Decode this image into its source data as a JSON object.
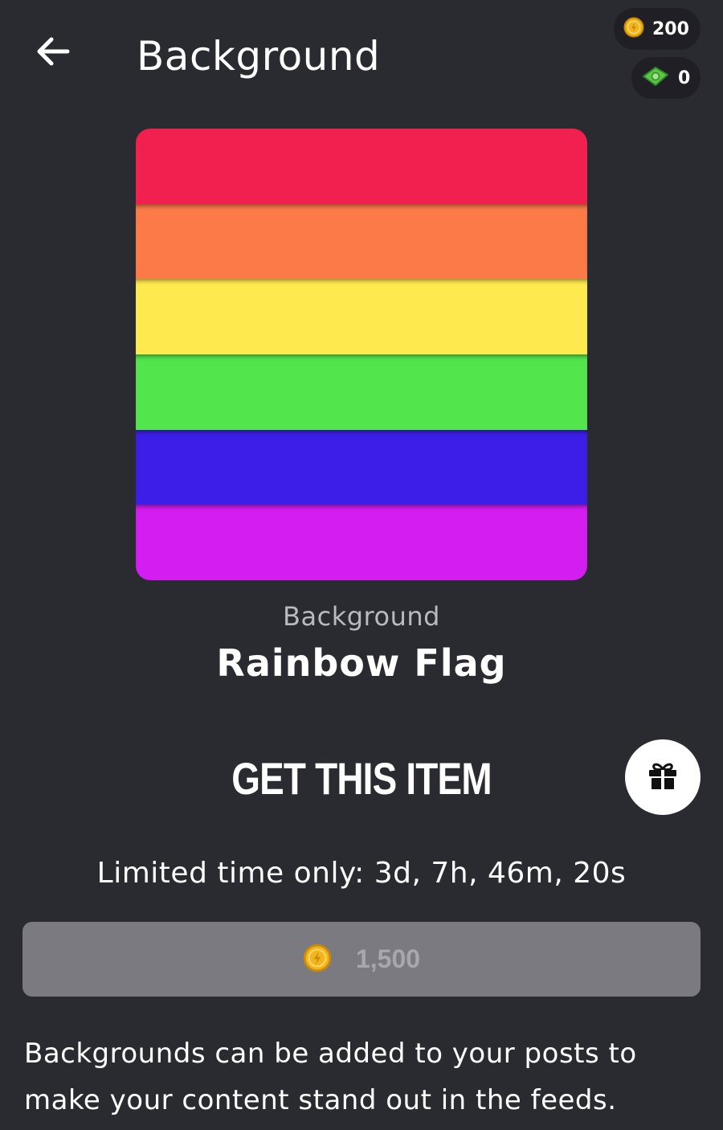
{
  "header": {
    "title": "Background"
  },
  "wallet": {
    "coins": "200",
    "cash": "0"
  },
  "item": {
    "category": "Background",
    "name": "Rainbow Flag",
    "stripes": [
      "#f2204f",
      "#fb7a48",
      "#fdea4f",
      "#53e54c",
      "#3d1de8",
      "#d41df0"
    ]
  },
  "purchase": {
    "heading": "GET THIS ITEM",
    "limited_time": "Limited time only: 3d, 7h, 46m, 20s",
    "price": "1,500"
  },
  "description": "Backgrounds can be added to your posts to make your content stand out in the feeds.",
  "icons": {
    "back": "arrow-left-icon",
    "coin": "coin-icon",
    "cash": "cash-icon",
    "gift": "gift-icon"
  }
}
